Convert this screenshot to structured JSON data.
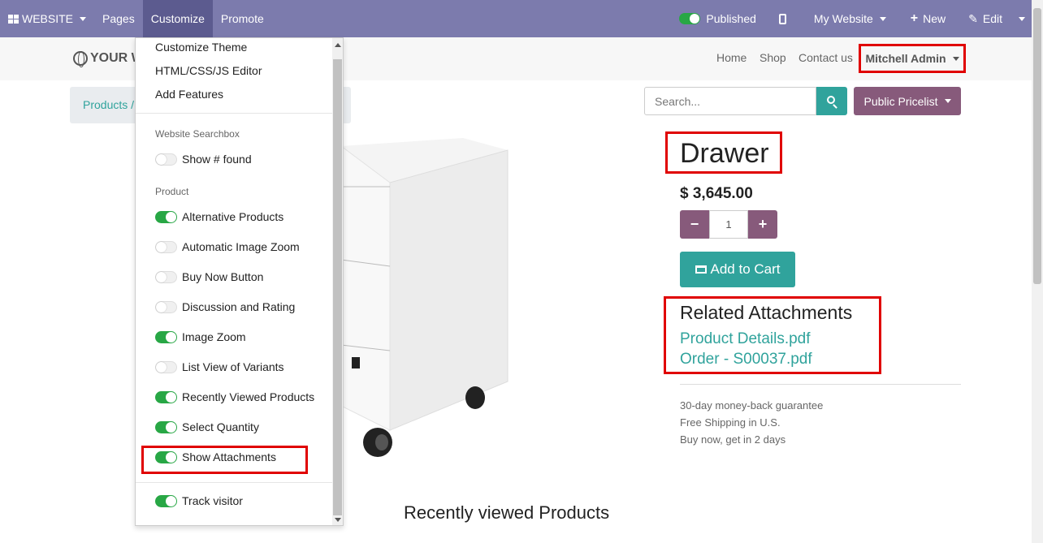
{
  "topbar": {
    "website_label": "WEBSITE",
    "pages_label": "Pages",
    "customize_label": "Customize",
    "promote_label": "Promote",
    "published_label": "Published",
    "my_website_label": "My Website",
    "new_label": "New",
    "edit_label": "Edit",
    "bar_color": "#7c7bad"
  },
  "header": {
    "logo_text": "YOUR W",
    "nav": [
      "Home",
      "Shop",
      "Contact us"
    ],
    "user_name": "Mitchell Admin"
  },
  "breadcrumb": {
    "first": "Products /"
  },
  "search": {
    "placeholder": "Search...",
    "pricelist_label": "Public Pricelist"
  },
  "product": {
    "name": "Drawer",
    "price": "$ 3,645.00",
    "quantity": "1",
    "add_to_cart_label": "Add to Cart",
    "related_title": "Related Attachments",
    "attachments": [
      "Product Details.pdf",
      "Order - S00037.pdf"
    ],
    "guarantees": [
      "30-day money-back guarantee",
      "Free Shipping in U.S.",
      "Buy now, get in 2 days"
    ]
  },
  "recent_title": "Recently viewed Products",
  "customize_menu": {
    "items": [
      "Customize Theme",
      "HTML/CSS/JS Editor",
      "Add Features"
    ],
    "section_searchbox": "Website Searchbox",
    "show_found": {
      "label": "Show # found",
      "on": false
    },
    "section_product": "Product",
    "product_options": [
      {
        "label": "Alternative Products",
        "on": true
      },
      {
        "label": "Automatic Image Zoom",
        "on": false
      },
      {
        "label": "Buy Now Button",
        "on": false
      },
      {
        "label": "Discussion and Rating",
        "on": false
      },
      {
        "label": "Image Zoom",
        "on": true
      },
      {
        "label": "List View of Variants",
        "on": false
      },
      {
        "label": "Recently Viewed Products",
        "on": true
      },
      {
        "label": "Select Quantity",
        "on": true
      },
      {
        "label": "Show Attachments",
        "on": true
      }
    ],
    "track_visitor": {
      "label": "Track visitor",
      "on": true
    }
  },
  "colors": {
    "teal": "#30a39c",
    "purple": "#875a7b",
    "highlight_red": "#e00000",
    "toggle_green": "#28a745"
  }
}
